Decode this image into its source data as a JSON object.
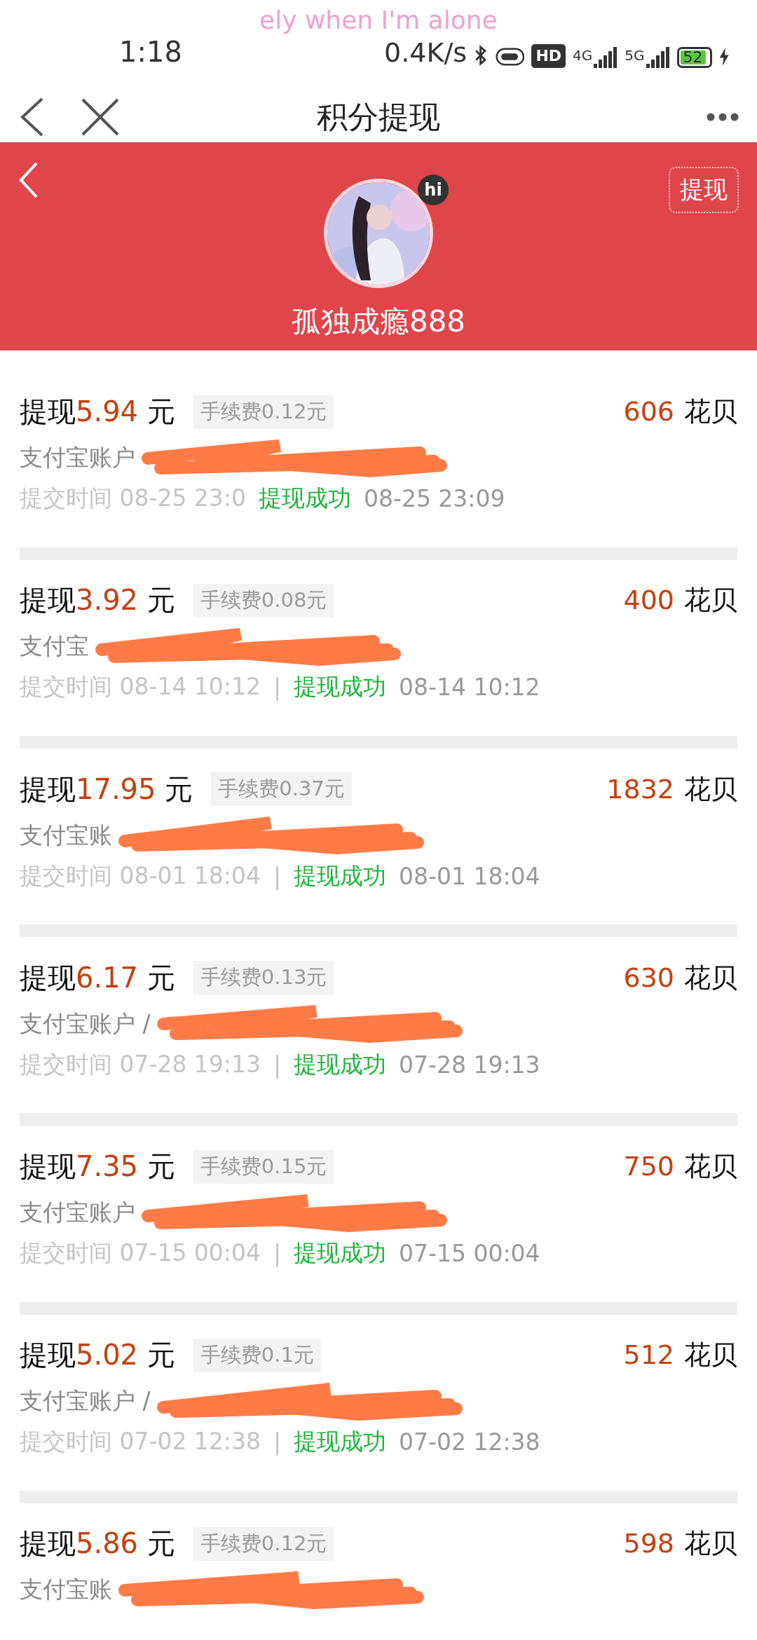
{
  "status_bar": {
    "overlay_text": "ely when I'm alone",
    "time": "1:18",
    "speed": "0.4K/s",
    "hd_label": "HD",
    "network_a": "4G",
    "network_b": "5G",
    "battery": "52"
  },
  "nav": {
    "title": "积分提现"
  },
  "header": {
    "button": "提现",
    "badge": "hi",
    "name": "孤独成瘾888"
  },
  "records": [
    {
      "prefix": "提现",
      "amount": "5.94",
      "unit": "元",
      "fee": "手续费0.12元",
      "points": "606",
      "points_unit": "花贝",
      "account": "支付宝账户",
      "submit_time": "提交时间 08-25 23:0",
      "status": "提现成功",
      "finish_time": "08-25 23:09"
    },
    {
      "prefix": "提现",
      "amount": "3.92",
      "unit": "元",
      "fee": "手续费0.08元",
      "points": "400",
      "points_unit": "花贝",
      "account": "支付宝",
      "submit_time": "提交时间 08-14 10:12",
      "separator": "|",
      "status": "提现成功",
      "finish_time": "08-14 10:12"
    },
    {
      "prefix": "提现",
      "amount": "17.95",
      "unit": "元",
      "fee": "手续费0.37元",
      "points": "1832",
      "points_unit": "花贝",
      "account": "支付宝账",
      "submit_time": "提交时间 08-01 18:04",
      "separator": "|",
      "status": "提现成功",
      "finish_time": "08-01 18:04"
    },
    {
      "prefix": "提现",
      "amount": "6.17",
      "unit": "元",
      "fee": "手续费0.13元",
      "points": "630",
      "points_unit": "花贝",
      "account": "支付宝账户 /",
      "submit_time": "提交时间 07-28 19:13",
      "separator": "|",
      "status": "提现成功",
      "finish_time": "07-28 19:13"
    },
    {
      "prefix": "提现",
      "amount": "7.35",
      "unit": "元",
      "fee": "手续费0.15元",
      "points": "750",
      "points_unit": "花贝",
      "account": "支付宝账户",
      "submit_time": "提交时间 07-15 00:04",
      "separator": "|",
      "status": "提现成功",
      "finish_time": "07-15 00:04"
    },
    {
      "prefix": "提现",
      "amount": "5.02",
      "unit": "元",
      "fee": "手续费0.1元",
      "points": "512",
      "points_unit": "花贝",
      "account": "支付宝账户 /",
      "submit_time": "提交时间 07-02 12:38",
      "separator": "|",
      "status": "提现成功",
      "finish_time": "07-02 12:38"
    },
    {
      "prefix": "提现",
      "amount": "5.86",
      "unit": "元",
      "fee": "手续费0.12元",
      "points": "598",
      "points_unit": "花贝",
      "account": "支付宝账"
    }
  ]
}
